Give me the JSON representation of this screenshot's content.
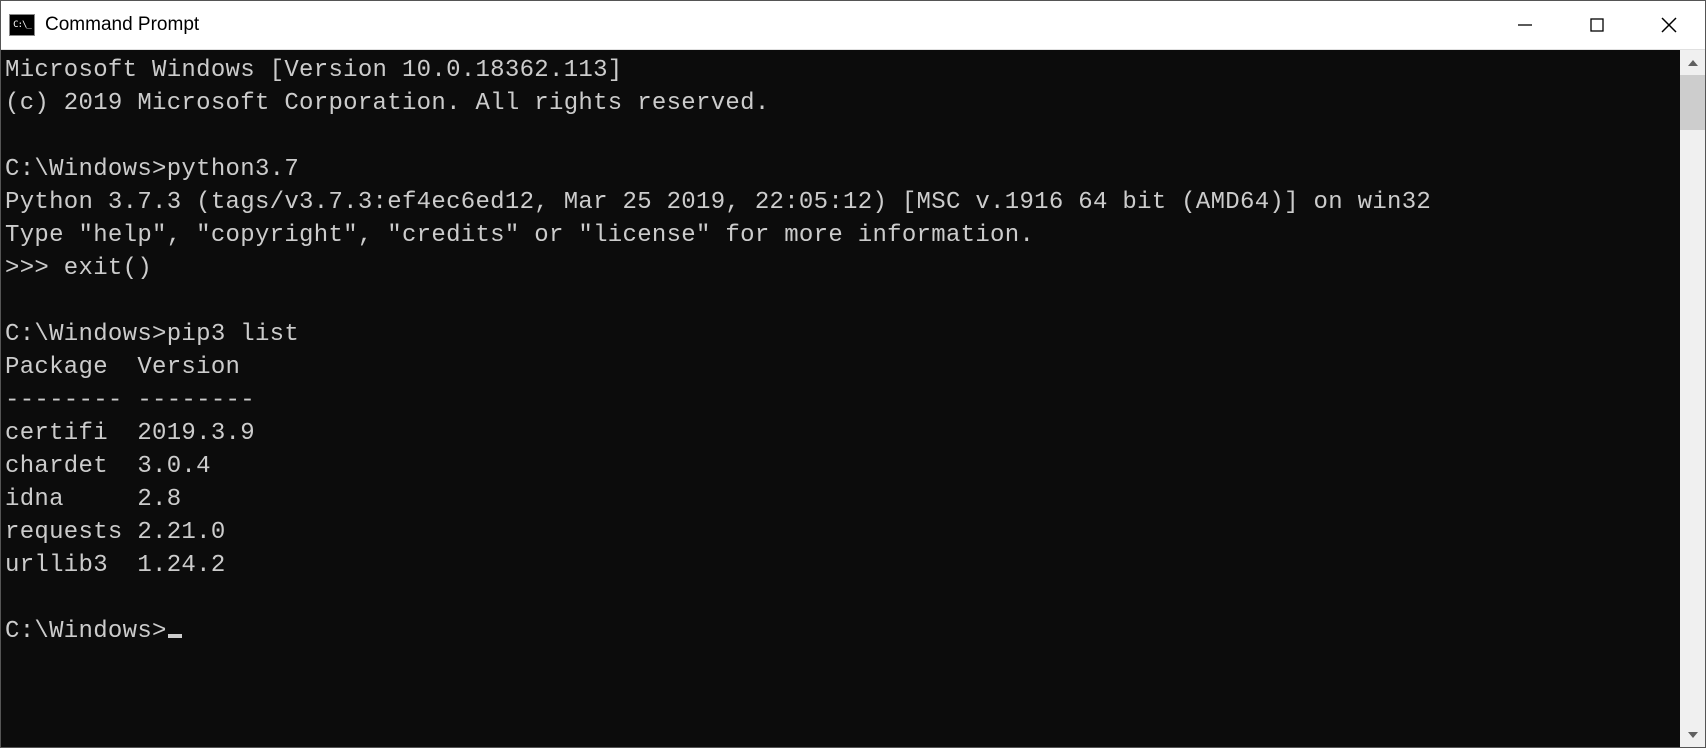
{
  "window": {
    "title": "Command Prompt"
  },
  "terminal": {
    "line1": "Microsoft Windows [Version 10.0.18362.113]",
    "line2": "(c) 2019 Microsoft Corporation. All rights reserved.",
    "blank1": "",
    "prompt1": "C:\\Windows>python3.7",
    "py1": "Python 3.7.3 (tags/v3.7.3:ef4ec6ed12, Mar 25 2019, 22:05:12) [MSC v.1916 64 bit (AMD64)] on win32",
    "py2": "Type \"help\", \"copyright\", \"credits\" or \"license\" for more information.",
    "py3": ">>> exit()",
    "blank2": "",
    "prompt2": "C:\\Windows>pip3 list",
    "pkg_header": "Package  Version",
    "pkg_sep": "-------- --------",
    "pkg1": "certifi  2019.3.9",
    "pkg2": "chardet  3.0.4",
    "pkg3": "idna     2.8",
    "pkg4": "requests 2.21.0",
    "pkg5": "urllib3  1.24.2",
    "blank3": "",
    "prompt3": "C:\\Windows>"
  }
}
